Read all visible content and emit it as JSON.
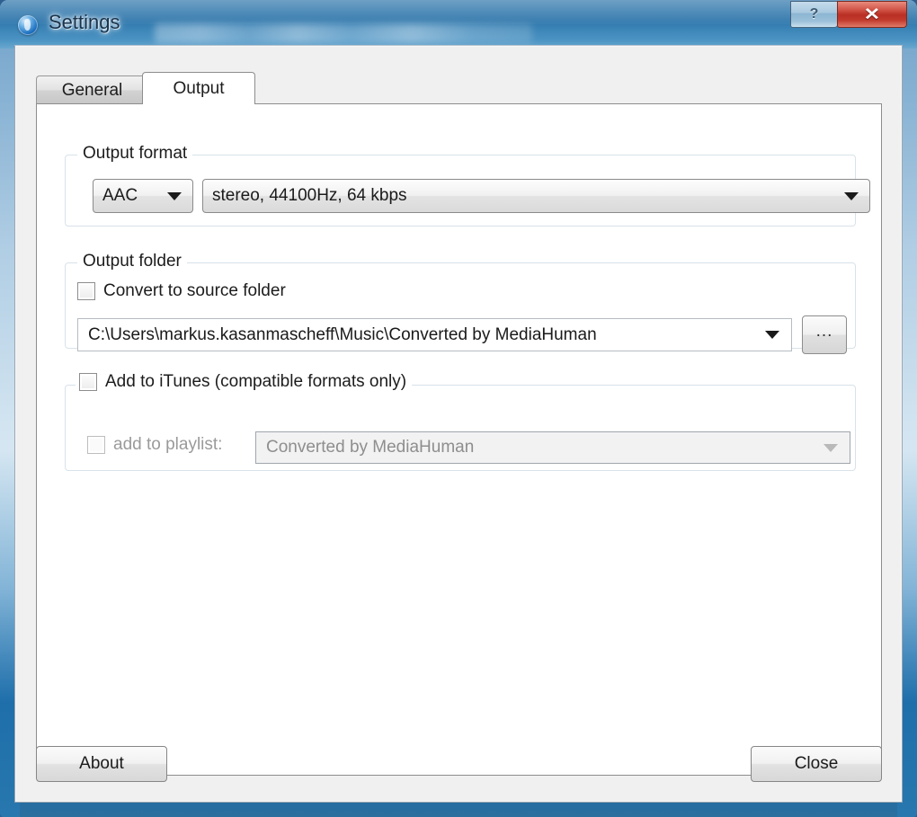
{
  "window": {
    "title": "Settings",
    "icon": "app-circle-icon",
    "controls": {
      "help_label": "?",
      "close_label": "✕"
    }
  },
  "tabs": [
    {
      "label": "General",
      "active": false
    },
    {
      "label": "Output",
      "active": true
    }
  ],
  "output_format": {
    "group_title": "Output format",
    "format_value": "AAC",
    "quality_value": "stereo, 44100Hz, 64 kbps"
  },
  "output_folder": {
    "group_title": "Output folder",
    "convert_to_source_label": "Convert to source folder",
    "convert_to_source_checked": false,
    "folder_path": "C:\\Users\\markus.kasanmascheff\\Music\\Converted by MediaHuman",
    "browse_label": "..."
  },
  "itunes": {
    "group_title": "Add to iTunes (compatible formats only)",
    "add_to_itunes_checked": false,
    "playlist_label": "add to playlist:",
    "playlist_checked": false,
    "playlist_value": "Converted by MediaHuman",
    "playlist_disabled": true
  },
  "footer": {
    "about_label": "About",
    "close_label": "Close"
  },
  "colors": {
    "title_bar_blue": "#2e76ab",
    "close_button_red": "#b92f24",
    "client_background": "#f0f0f0",
    "tab_page_background": "#ffffff",
    "group_border": "#d8e2ea",
    "disabled_text": "#8e8e8e"
  }
}
